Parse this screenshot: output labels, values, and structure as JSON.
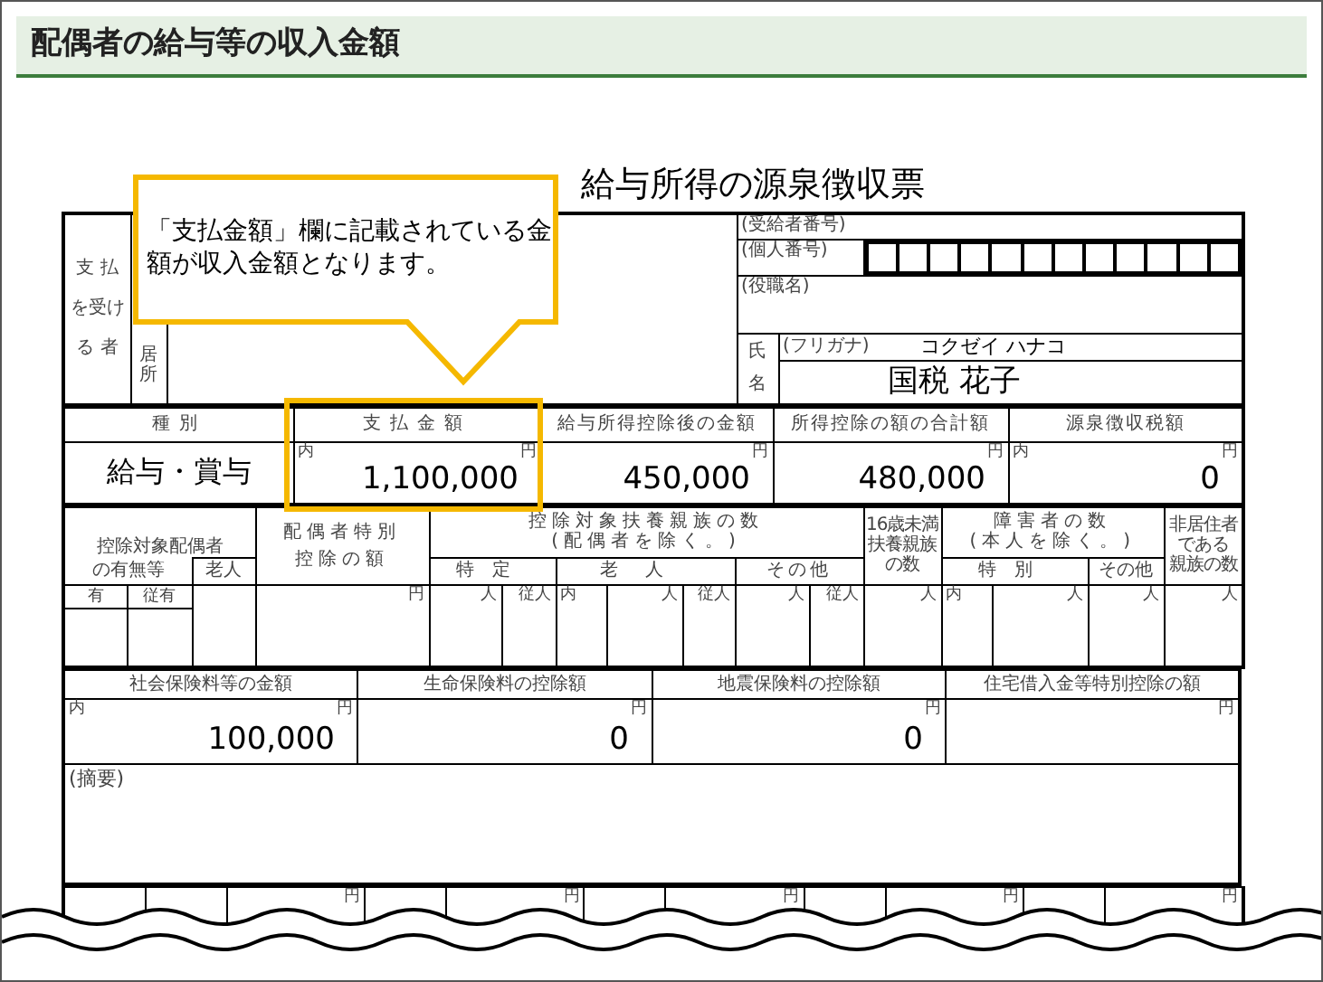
{
  "header": {
    "title": "配偶者の給与等の収入金額"
  },
  "form": {
    "title": "給与所得の源泉徴収票",
    "recipient": {
      "label_lines": [
        "支 払",
        "を受け",
        "る 者"
      ],
      "address_label": "居所",
      "number_label": "(受給者番号)",
      "my_number_label": "(個人番号)",
      "position_label": "(役職名)",
      "name_label_lines": [
        "氏",
        "名"
      ],
      "furigana_label": "(フリガナ)",
      "furigana": "コクゼイ ハナコ",
      "name": "国税 花子"
    },
    "amounts": {
      "columns": [
        "種別",
        "支払金額",
        "給与所得控除後の金額",
        "所得控除の額の合計額",
        "源泉徴収税額"
      ],
      "type": "給与・賞与",
      "cells": [
        {
          "prefix": "内",
          "unit": "円",
          "value": "1,100,000",
          "highlighted": true
        },
        {
          "unit": "円",
          "value": "450,000",
          "highlighted": false
        },
        {
          "unit": "円",
          "value": "480,000",
          "highlighted": false
        },
        {
          "prefix": "内",
          "unit": "円",
          "value": "0",
          "highlighted": false
        }
      ]
    },
    "dependents": {
      "spouse_label_lines": [
        "控除対象配偶者",
        "の有無等"
      ],
      "spouse_elderly": "老人",
      "special_label_lines": [
        "配偶者特別",
        "控除の額"
      ],
      "dependents_label_lines": [
        "控除対象扶養親族の数",
        "(配偶者を除く。)"
      ],
      "dependents_groups": [
        "特定",
        "老人",
        "その他"
      ],
      "under16_label_lines": [
        "16歳未満",
        "扶養親族",
        "の数"
      ],
      "disabled_label_lines": [
        "障害者の数",
        "(本人を除く。)"
      ],
      "disabled_groups": [
        "特別",
        "その他"
      ],
      "nonresident_label_lines": [
        "非居住者",
        "である",
        "親族の数"
      ],
      "spouse_subs": [
        "有",
        "従有"
      ],
      "units": [
        {
          "kind": "unit",
          "text": "円"
        },
        {
          "kind": "unit",
          "text": "人"
        },
        {
          "kind": "unit",
          "text": "従人"
        },
        {
          "kind": "prefix",
          "text": "内"
        },
        {
          "kind": "unit",
          "text": "人"
        },
        {
          "kind": "unit",
          "text": "従人"
        },
        {
          "kind": "unit",
          "text": "人"
        },
        {
          "kind": "unit",
          "text": "従人"
        },
        {
          "kind": "unit",
          "text": "人"
        },
        {
          "kind": "prefix",
          "text": "内"
        },
        {
          "kind": "unit",
          "text": "人"
        },
        {
          "kind": "unit",
          "text": "人"
        },
        {
          "kind": "unit",
          "text": "人"
        }
      ]
    },
    "insurance": {
      "columns": [
        "社会保険料等の金額",
        "生命保険料の控除額",
        "地震保険料の控除額",
        "住宅借入金等特別控除の額"
      ],
      "cells": [
        {
          "prefix": "内",
          "unit": "円",
          "value": "100,000"
        },
        {
          "unit": "円",
          "value": "0"
        },
        {
          "unit": "円",
          "value": "0"
        },
        {
          "unit": "円"
        }
      ]
    },
    "remarks_label": "(摘要)",
    "bottom_row": {
      "cells": [
        {
          "kind": "label"
        },
        {
          "kind": "label"
        },
        {
          "kind": "amount",
          "unit": "円"
        },
        {
          "kind": "label"
        },
        {
          "kind": "amount",
          "unit": "円"
        },
        {
          "kind": "label"
        },
        {
          "kind": "amount",
          "unit": "円"
        },
        {
          "kind": "label"
        },
        {
          "kind": "amount",
          "unit": "円"
        },
        {
          "kind": "label"
        },
        {
          "kind": "amount",
          "unit": "円"
        }
      ]
    }
  },
  "callout": {
    "text": "「支払金額」欄に記載されている金額が収入金額となります。"
  }
}
